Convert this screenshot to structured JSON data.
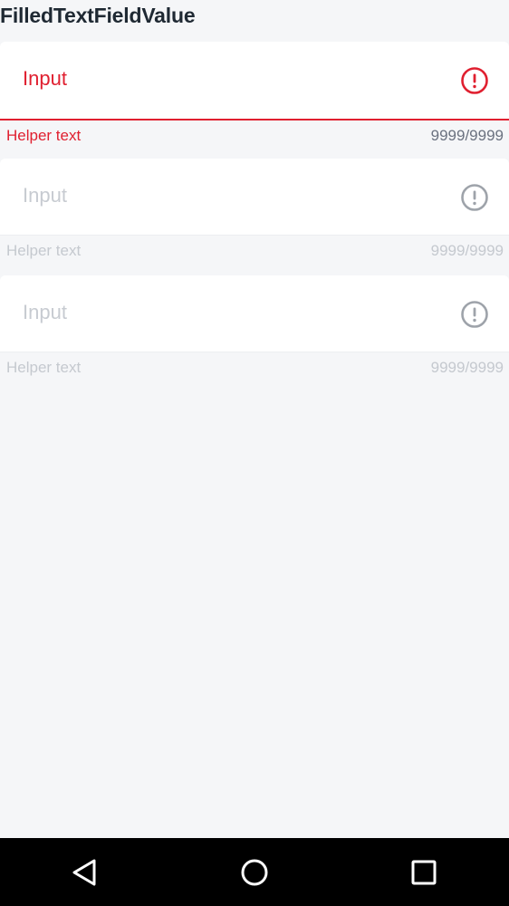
{
  "page": {
    "title": "FilledTextFieldValue"
  },
  "fields": [
    {
      "placeholder": "Input",
      "helper": "Helper text",
      "counter": "9999/9999",
      "state": "error",
      "icon": "error-icon",
      "icon_color": "#e02030"
    },
    {
      "placeholder": "Input",
      "helper": "Helper text",
      "counter": "9999/9999",
      "state": "disabled",
      "icon": "error-icon",
      "icon_color": "#9ea3aa"
    },
    {
      "placeholder": "Input",
      "helper": "Helper text",
      "counter": "9999/9999",
      "state": "disabled",
      "icon": "error-icon",
      "icon_color": "#9ea3aa"
    }
  ],
  "nav": {
    "back": "back-icon",
    "home": "home-icon",
    "recents": "recents-icon"
  },
  "colors": {
    "error": "#e02030",
    "background": "#f5f6f8",
    "field_background": "#ffffff",
    "muted": "#c5c9cf"
  }
}
